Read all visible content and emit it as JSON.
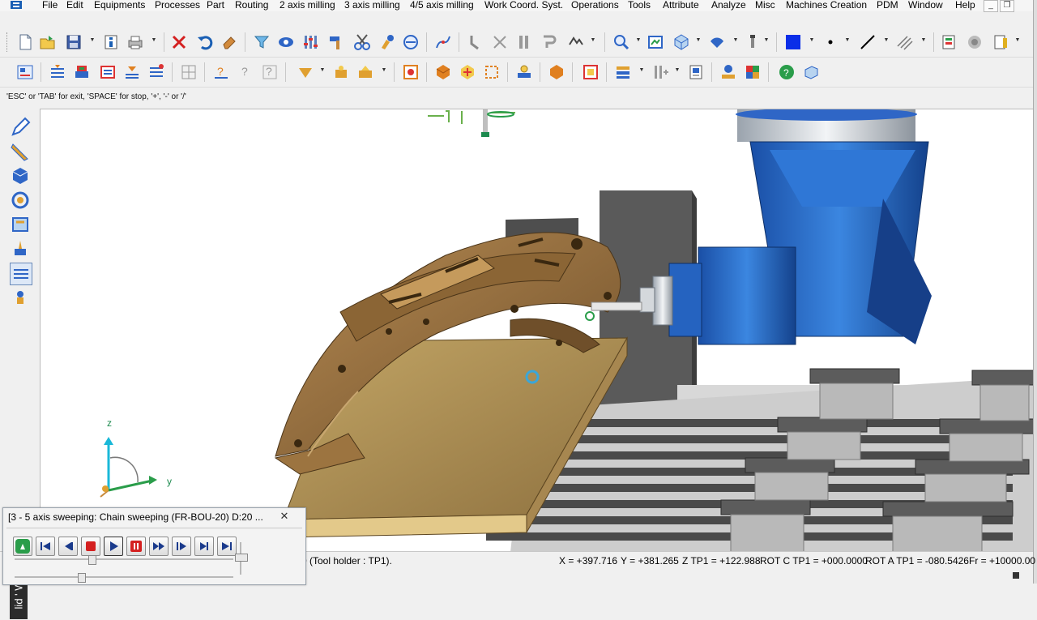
{
  "menu": {
    "items": [
      "File",
      "Edit",
      "Equipments",
      "Processes",
      "Part",
      "Routing",
      "2 axis milling",
      "3 axis milling",
      "4/5 axis milling",
      "Work Coord. Syst.",
      "Operations",
      "Tools",
      "Attribute",
      "Analyze",
      "Misc",
      "Machines Creation",
      "PDM",
      "Window",
      "Help"
    ]
  },
  "window_controls": {
    "minimize": "_",
    "restore": "❐"
  },
  "toolbar1": {
    "icons": [
      "new-file-icon",
      "open-file-icon",
      "save-icon",
      "properties-icon",
      "print-icon",
      "delete-icon",
      "undo-icon",
      "eraser-icon",
      "select-filter-icon",
      "show-hide-icon",
      "entity-attributes-icon",
      "hammer-icon",
      "scissors-icon",
      "paint-icon",
      "measure-icon",
      "curve-edit-icon",
      "trim-icon",
      "extend-icon",
      "bend-icon",
      "chain-icon",
      "zoom-icon",
      "fit-view-icon",
      "view-orientation-icon",
      "shading-icon",
      "layer-icon",
      "color-swatch-icon",
      "point-style-icon",
      "line-style-icon",
      "hatch-icon",
      "text-style-icon",
      "render-mode-icon",
      "level-icon"
    ],
    "color_swatch": "#0a2ee8"
  },
  "toolbar2": {
    "icons": [
      "machine-setup-icon",
      "part-orientation-icon",
      "stock-icon",
      "fixture-icon",
      "clamp-icon",
      "toolpath-list-icon",
      "help-question-icon",
      "help-context-icon",
      "help-whatsnew-icon",
      "pocket-icon",
      "drill-icon",
      "profile-icon",
      "tool-library-icon",
      "simulation-icon",
      "verify-icon",
      "post-processor-icon",
      "nc-code-icon",
      "report-icon",
      "stack-icon",
      "batch-icon",
      "sheet-icon",
      "camera-icon",
      "color-palette-icon",
      "green-check-icon",
      "box-3d-icon"
    ]
  },
  "prompt": {
    "text": "'ESC' or 'TAB' for exit, 'SPACE' for stop, '+', '-' or '/'"
  },
  "left_toolbar": {
    "icons": [
      "pencil-icon",
      "ruler-icon",
      "solid-icon",
      "surface-icon",
      "wireframe-icon",
      "dimension-icon",
      "layers-panel-icon",
      "transform-icon"
    ]
  },
  "brand": {
    "text": "lid ' WoodCam"
  },
  "triad": {
    "z": "z",
    "y": "y"
  },
  "status": {
    "tool_holder": "0   (Tool holder : TP1).",
    "x": "X = +397.716",
    "y": "Y = +381.265",
    "z": "Z TP1 = +122.988",
    "rot_c": "ROT C TP1 = +000.0000",
    "rot_a": "ROT A TP1 = -080.5426",
    "fr": "Fr = +10000.00"
  },
  "simulation_panel": {
    "title": "[3 - 5 axis sweeping: Chain sweeping   (FR-BOU-20)  D:20  ...",
    "close": "✕",
    "buttons": [
      "start-icon",
      "first-icon",
      "previous-icon",
      "stop-icon",
      "play-icon",
      "pause-icon",
      "fast-forward-icon",
      "step-icon",
      "next-icon",
      "last-icon"
    ],
    "progress": 0.35
  },
  "colors": {
    "spindle_blue": "#1f63c8",
    "wood": "#9c7440",
    "board": "#b99a5a",
    "table_gray": "#b6b6b6",
    "axis_green": "#1c8a4e"
  }
}
